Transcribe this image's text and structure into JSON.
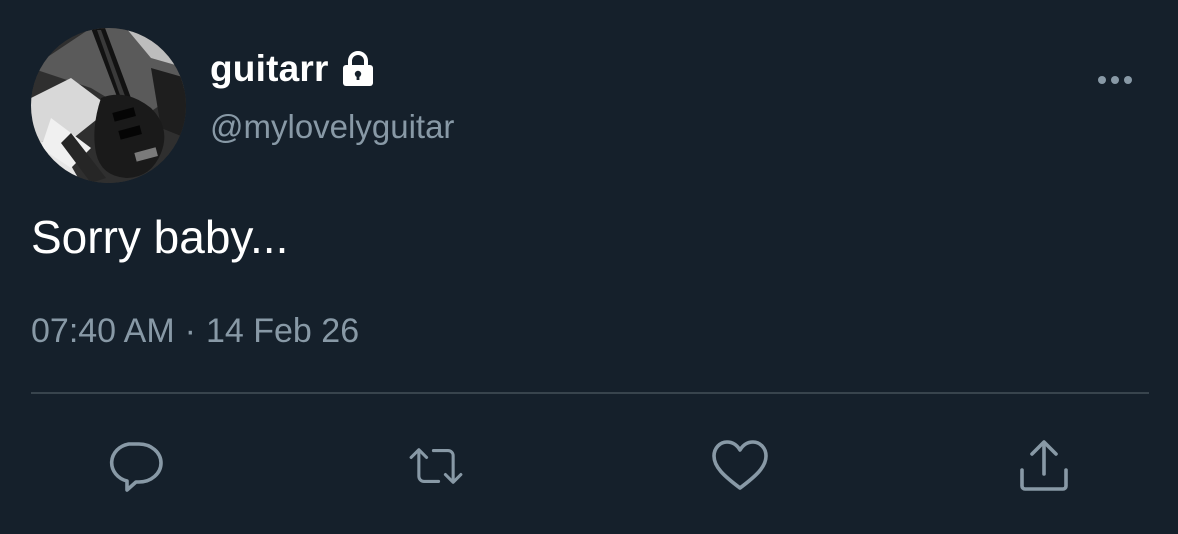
{
  "profile": {
    "display_name": "guitarr",
    "handle": "@mylovelyguitar",
    "protected_icon": "lock-icon",
    "avatar_icon": "avatar-guitar-photo"
  },
  "tweet": {
    "text": "Sorry baby...",
    "time": "07:40 AM",
    "separator": "·",
    "date": "14 Feb 26"
  },
  "actions": {
    "more": "more-options-icon",
    "reply": "reply-icon",
    "retweet": "retweet-icon",
    "like": "like-icon",
    "share": "share-icon"
  },
  "colors": {
    "background": "#15202b",
    "text_primary": "#ffffff",
    "text_secondary": "#8899a6",
    "divider": "#38444d"
  }
}
